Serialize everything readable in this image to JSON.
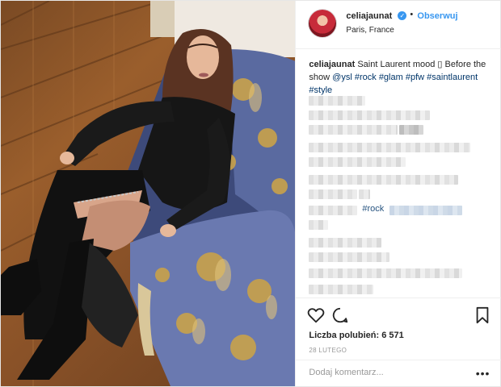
{
  "post": {
    "username": "celiajaunat",
    "verified_icon": "verified-badge-icon",
    "separator": "•",
    "follow_label": "Obserwuj",
    "location": "Paris, France",
    "caption": {
      "username": "celiajaunat",
      "text_before": "Saint Laurent mood",
      "emoji_placeholder": "▯",
      "text_after": "Before the show",
      "mention": "@ysl",
      "hashtags": [
        "#rock",
        "#glam",
        "#pfw",
        "#saintlaurent",
        "#style"
      ]
    },
    "likes_label": "Liczba polubień: 6 571",
    "date": "28 LUTEGO",
    "comment_placeholder": "Dodaj komentarz...",
    "more_label": "•••",
    "visible_blurred_tags": [
      "#rock"
    ]
  },
  "colors": {
    "link": "#3897f0",
    "hashtag": "#003569",
    "text": "#262626",
    "muted": "#999999",
    "border": "#efefef"
  },
  "icons": {
    "like": "heart-icon",
    "comment": "speech-bubble-icon",
    "save": "bookmark-icon"
  }
}
